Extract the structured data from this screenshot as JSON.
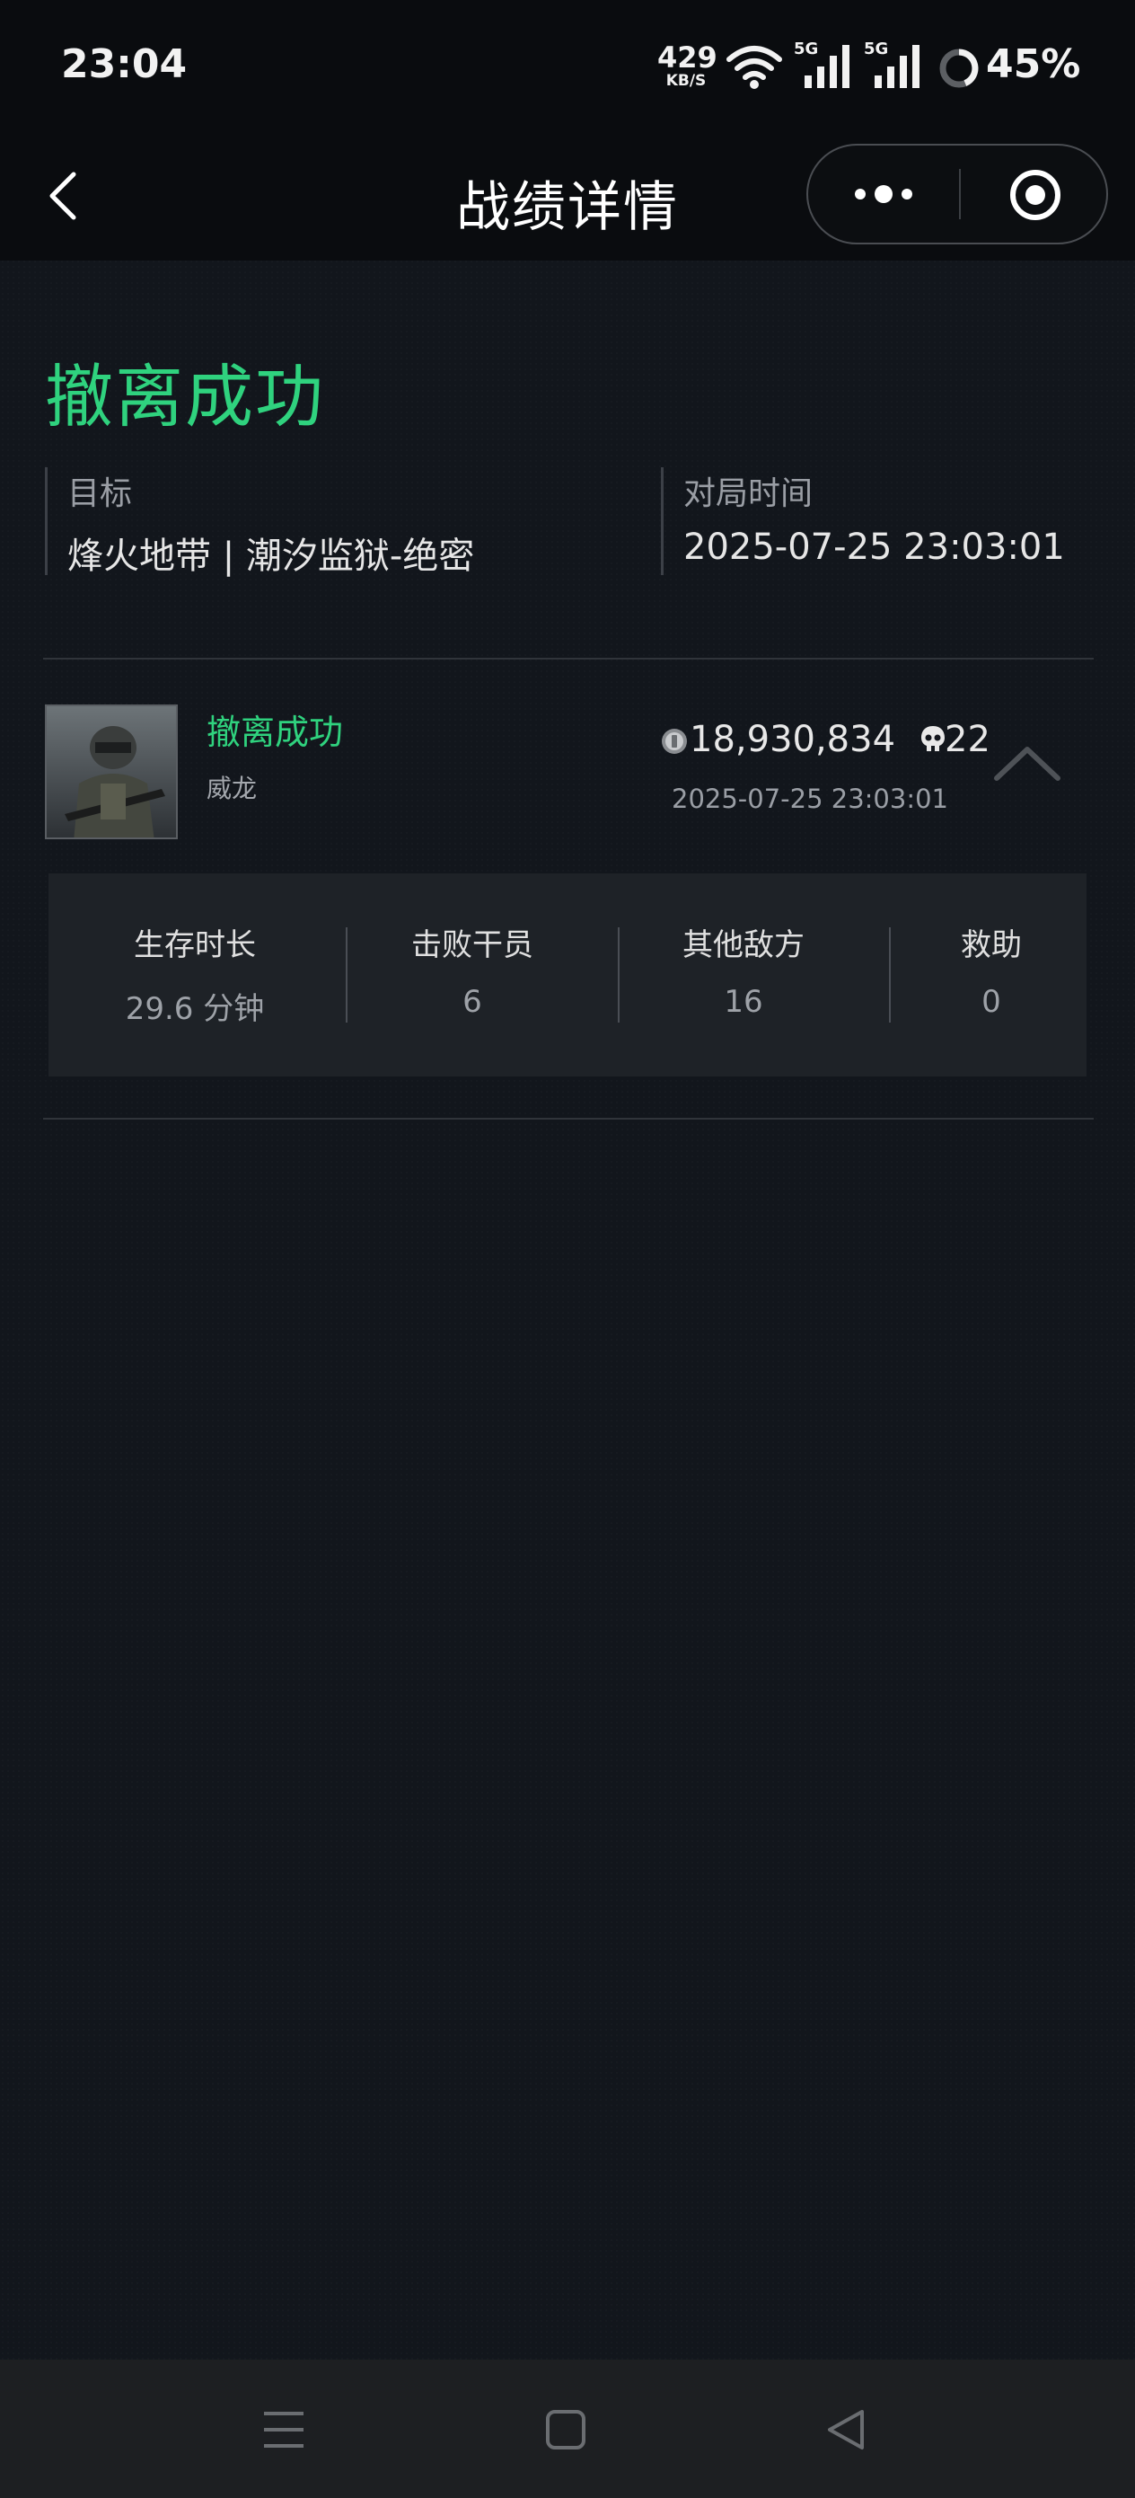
{
  "status_bar": {
    "time": "23:04",
    "net_speed_value": "429",
    "net_speed_unit": "KB/S",
    "signal_1_label": "5G",
    "signal_2_label": "5G",
    "battery_percent": "45%",
    "battery_level": 0.45
  },
  "nav": {
    "title": "战绩详情"
  },
  "summary": {
    "result": "撤离成功",
    "target_label": "目标",
    "target_value": "烽火地带 | 潮汐监狱-绝密",
    "time_label": "对局时间",
    "time_value": "2025-07-25 23:03:01"
  },
  "record": {
    "status": "撤离成功",
    "operator": "威龙",
    "money": "18,930,834",
    "kills": "22",
    "timestamp": "2025-07-25 23:03:01"
  },
  "stats": [
    {
      "label": "生存时长",
      "value": "29.6 分钟"
    },
    {
      "label": "击败干员",
      "value": "6"
    },
    {
      "label": "其他敌方",
      "value": "16"
    },
    {
      "label": "救助",
      "value": "0"
    }
  ],
  "colors": {
    "accent_green": "#2fd27e",
    "background": "#12161c",
    "panel": "#1e2227"
  },
  "icons": [
    "wifi-icon",
    "signal-icon",
    "battery-ring-icon",
    "back-icon",
    "more-icon",
    "close-target-icon",
    "coin-icon",
    "skull-icon",
    "chevron-up-icon",
    "menu-icon",
    "home-icon",
    "back-triangle-icon"
  ]
}
